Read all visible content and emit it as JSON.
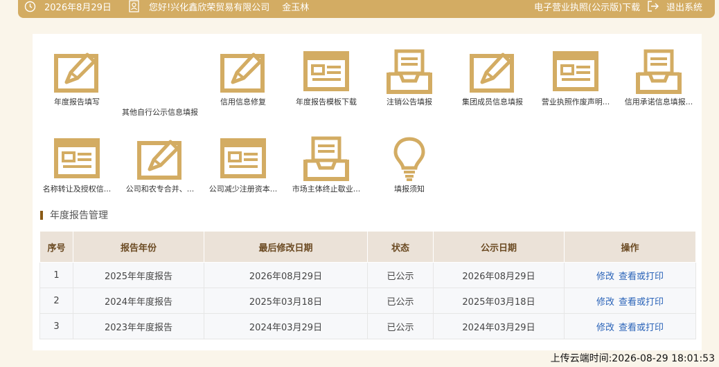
{
  "topbar": {
    "date": "2026年8月29日",
    "company": "您好!兴化鑫欣荣贸易有限公司",
    "user": "金玉林",
    "license_download": "电子营业执照(公示版)下载",
    "logout": "退出系统"
  },
  "tiles": [
    {
      "label": "年度报告填写",
      "icon": "pencil-form-icon"
    },
    {
      "label": "其他自行公示信息填报",
      "icon": "none"
    },
    {
      "label": "信用信息修复",
      "icon": "pencil-form-icon"
    },
    {
      "label": "年度报告模板下载",
      "icon": "document-window-icon"
    },
    {
      "label": "注销公告填报",
      "icon": "inbox-tray-icon"
    },
    {
      "label": "集团成员信息填报",
      "icon": "pencil-form-icon"
    },
    {
      "label": "营业执照作废声明...",
      "icon": "document-window-icon"
    },
    {
      "label": "信用承诺信息填报...",
      "icon": "inbox-tray-icon"
    },
    {
      "label": "名称转让及授权信...",
      "icon": "document-window-icon"
    },
    {
      "label": "公司和农专合并、...",
      "icon": "pencil-form-icon"
    },
    {
      "label": "公司减少注册资本...",
      "icon": "document-window-icon"
    },
    {
      "label": "市场主体终止歇业...",
      "icon": "inbox-tray-icon"
    },
    {
      "label": "填报须知",
      "icon": "lightbulb-icon"
    }
  ],
  "section": {
    "title": "年度报告管理"
  },
  "table": {
    "headers": [
      "序号",
      "报告年份",
      "最后修改日期",
      "状态",
      "公示日期",
      "操作"
    ],
    "rows": [
      {
        "no": "1",
        "year": "2025年年度报告",
        "modified": "2026年08月29日",
        "status": "已公示",
        "published": "2026年08月29日"
      },
      {
        "no": "2",
        "year": "2024年年度报告",
        "modified": "2025年03月18日",
        "status": "已公示",
        "published": "2025年03月18日"
      },
      {
        "no": "3",
        "year": "2023年年度报告",
        "modified": "2024年03月29日",
        "status": "已公示",
        "published": "2024年03月29日"
      }
    ],
    "action_edit": "修改",
    "action_view": "查看或打印"
  },
  "footer": {
    "upload_time": "上传云端时间:2026-08-29 18:01:53"
  },
  "colors": {
    "accent": "#d3ac63",
    "header_bg": "#ebe2d8",
    "link": "#2a63b8"
  }
}
